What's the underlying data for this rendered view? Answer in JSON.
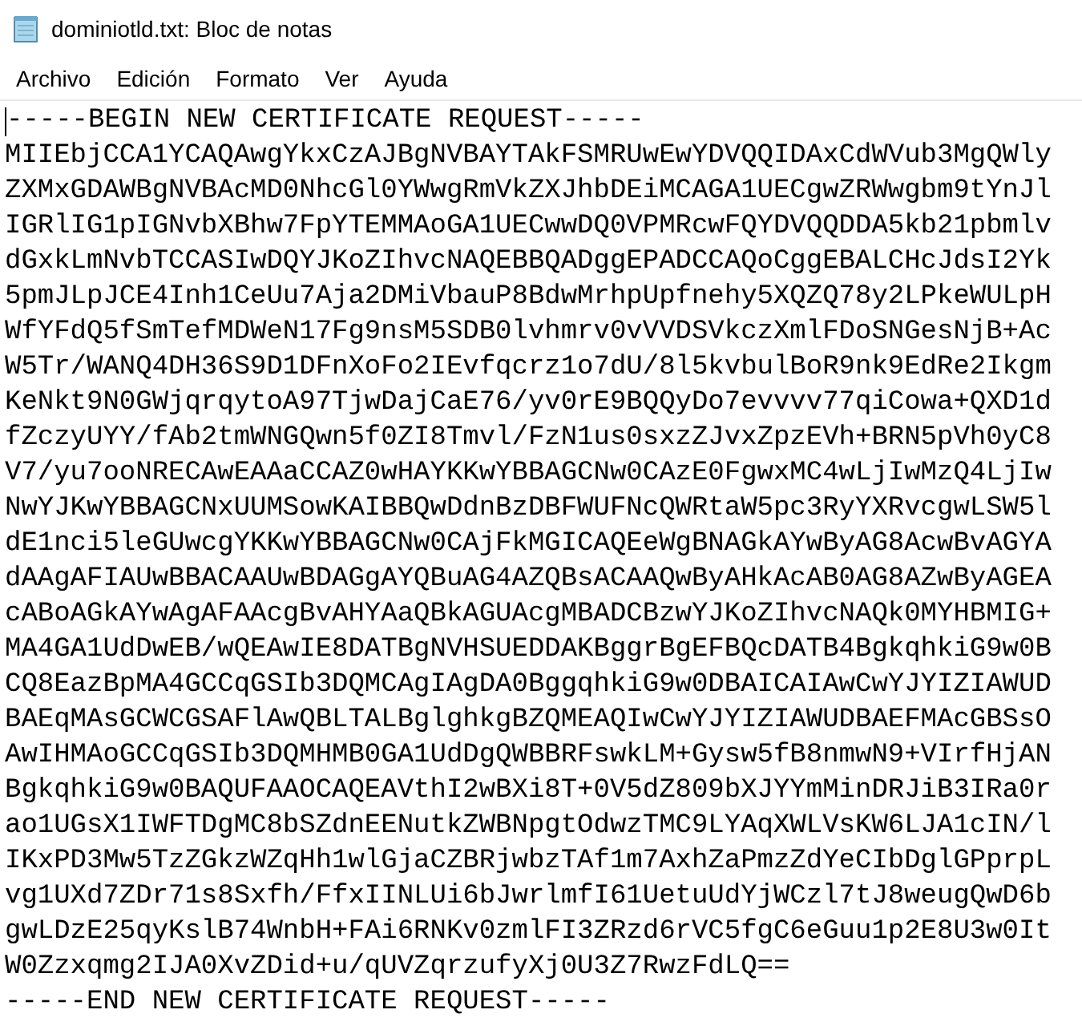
{
  "window": {
    "title": "dominiotld.txt: Bloc de notas"
  },
  "menu": [
    {
      "label": "Archivo"
    },
    {
      "label": "Edición"
    },
    {
      "label": "Formato"
    },
    {
      "label": "Ver"
    },
    {
      "label": "Ayuda"
    }
  ],
  "document": {
    "lines": [
      "-----BEGIN NEW CERTIFICATE REQUEST-----",
      "MIIEbjCCA1YCAQAwgYkxCzAJBgNVBAYTAkFSMRUwEwYDVQQIDAxCdWVub3MgQWly",
      "ZXMxGDAWBgNVBAcMD0NhcGl0YWwgRmVkZXJhbDEiMCAGA1UECgwZRWwgbm9tYnJl",
      "IGRlIG1pIGNvbXBhw7FpYTEMMAoGA1UECwwDQ0VPMRcwFQYDVQQDDA5kb21pbmlv",
      "dGxkLmNvbTCCASIwDQYJKoZIhvcNAQEBBQADggEPADCCAQoCggEBALCHcJdsI2Yk",
      "5pmJLpJCE4Inh1CeUu7Aja2DMiVbauP8BdwMrhpUpfnehy5XQZQ78y2LPkeWULpH",
      "WfYFdQ5fSmTefMDWeN17Fg9nsM5SDB0lvhmrv0vVVDSVkczXmlFDoSNGesNjB+Ac",
      "W5Tr/WANQ4DH36S9D1DFnXoFo2IEvfqcrz1o7dU/8l5kvbulBoR9nk9EdRe2Ikgm",
      "KeNkt9N0GWjqrqytoA97TjwDajCaE76/yv0rE9BQQyDo7evvvv77qiCowa+QXD1d",
      "fZczyUYY/fAb2tmWNGQwn5f0ZI8Tmvl/FzN1us0sxzZJvxZpzEVh+BRN5pVh0yC8",
      "V7/yu7ooNRECAwEAAaCCAZ0wHAYKKwYBBAGCNw0CAzE0FgwxMC4wLjIwMzQ4LjIw",
      "NwYJKwYBBAGCNxUUMSowKAIBBQwDdnBzDBFWUFNcQWRtaW5pc3RyYXRvcgwLSW5l",
      "dE1nci5leGUwcgYKKwYBBAGCNw0CAjFkMGICAQEeWgBNAGkAYwByAG8AcwBvAGYA",
      "dAAgAFIAUwBBACAAUwBDAGgAYQBuAG4AZQBsACAAQwByAHkAcAB0AG8AZwByAGEA",
      "cABoAGkAYwAgAFAAcgBvAHYAaQBkAGUAcgMBADCBzwYJKoZIhvcNAQk0MYHBMIG+",
      "MA4GA1UdDwEB/wQEAwIE8DATBgNVHSUEDDAKBggrBgEFBQcDATB4BgkqhkiG9w0B",
      "CQ8EazBpMA4GCCqGSIb3DQMCAgIAgDA0BggqhkiG9w0DBAICAIAwCwYJYIZIAWUD",
      "BAEqMAsGCWCGSAFlAwQBLTALBglghkgBZQMEAQIwCwYJYIZIAWUDBAEFMAcGBSsO",
      "AwIHMAoGCCqGSIb3DQMHMB0GA1UdDgQWBBRFswkLM+Gysw5fB8nmwN9+VIrfHjAN",
      "BgkqhkiG9w0BAQUFAAOCAQEAVthI2wBXi8T+0V5dZ809bXJYYmMinDRJiB3IRa0r",
      "ao1UGsX1IWFTDgMC8bSZdnEENutkZWBNpgtOdwzTMC9LYAqXWLVsKW6LJA1cIN/l",
      "IKxPD3Mw5TzZGkzWZqHh1wlGjaCZBRjwbzTAf1m7AxhZaPmzZdYeCIbDglGPprpL",
      "vg1UXd7ZDr71s8Sxfh/FfxIINLUi6bJwrlmfI61UetuUdYjWCzl7tJ8weugQwD6b",
      "gwLDzE25qyKslB74WnbH+FAi6RNKv0zmlFI3ZRzd6rVC5fgC6eGuu1p2E8U3w0It",
      "W0Zzxqmg2IJA0XvZDid+u/qUVZqrzufyXj0U3Z7RwzFdLQ==",
      "-----END NEW CERTIFICATE REQUEST-----"
    ]
  }
}
